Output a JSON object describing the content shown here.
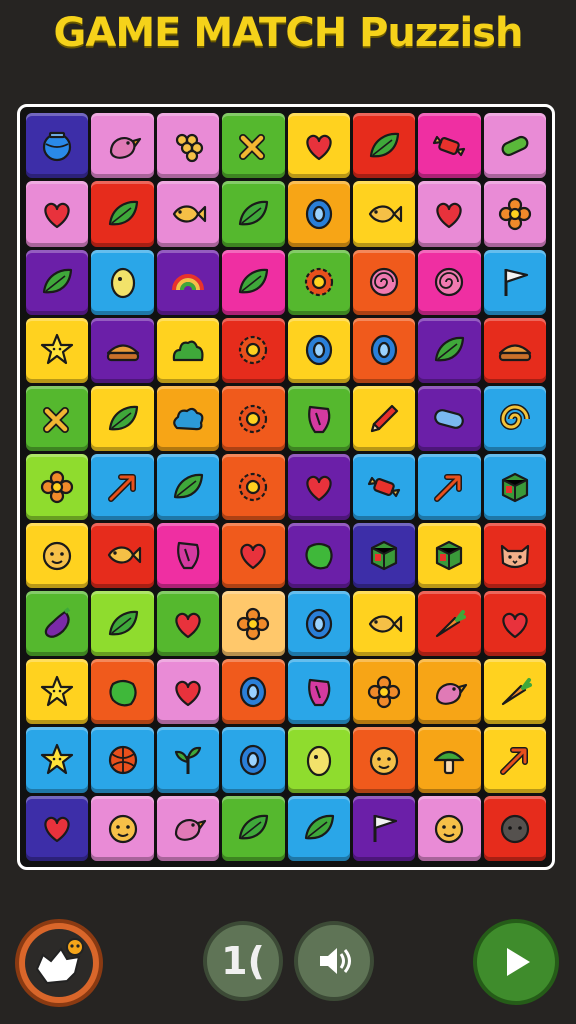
{
  "title": "GAME MATCH Puzzish",
  "tiles": [
    {
      "color": "#3d2ea8",
      "icon": "fish-bowl"
    },
    {
      "color": "#e98bd6",
      "icon": "bird"
    },
    {
      "color": "#e98bd6",
      "icon": "grapes"
    },
    {
      "color": "#55b82e",
      "icon": "cross"
    },
    {
      "color": "#ffd21f",
      "icon": "heart"
    },
    {
      "color": "#e62c1c",
      "icon": "leaf"
    },
    {
      "color": "#ef2fa2",
      "icon": "candy"
    },
    {
      "color": "#e98bd6",
      "icon": "pickle"
    },
    {
      "color": "#e98bd6",
      "icon": "heart"
    },
    {
      "color": "#e62c1c",
      "icon": "leaf"
    },
    {
      "color": "#e98bd6",
      "icon": "fish"
    },
    {
      "color": "#55b82e",
      "icon": "leaf"
    },
    {
      "color": "#f7a516",
      "icon": "ring"
    },
    {
      "color": "#ffd21f",
      "icon": "fish"
    },
    {
      "color": "#e98bd6",
      "icon": "heart"
    },
    {
      "color": "#e98bd6",
      "icon": "flower"
    },
    {
      "color": "#6b1fa8",
      "icon": "leaf"
    },
    {
      "color": "#2aa6e8",
      "icon": "egg"
    },
    {
      "color": "#6b1fa8",
      "icon": "rainbow"
    },
    {
      "color": "#ef2fa2",
      "icon": "leaf"
    },
    {
      "color": "#55b82e",
      "icon": "gear"
    },
    {
      "color": "#f05a1c",
      "icon": "spiral"
    },
    {
      "color": "#ef2fa2",
      "icon": "spiral"
    },
    {
      "color": "#2aa6e8",
      "icon": "flag"
    },
    {
      "color": "#ffd21f",
      "icon": "star"
    },
    {
      "color": "#6b1fa8",
      "icon": "pie"
    },
    {
      "color": "#ffd21f",
      "icon": "bush"
    },
    {
      "color": "#e62c1c",
      "icon": "gear"
    },
    {
      "color": "#ffd21f",
      "icon": "ring"
    },
    {
      "color": "#f05a1c",
      "icon": "ring"
    },
    {
      "color": "#6b1fa8",
      "icon": "leaf"
    },
    {
      "color": "#e62c1c",
      "icon": "pie"
    },
    {
      "color": "#55b82e",
      "icon": "cross"
    },
    {
      "color": "#ffd21f",
      "icon": "leaf"
    },
    {
      "color": "#f7a516",
      "icon": "cloud"
    },
    {
      "color": "#f05a1c",
      "icon": "gear"
    },
    {
      "color": "#55b82e",
      "icon": "shell"
    },
    {
      "color": "#ffd21f",
      "icon": "pencil"
    },
    {
      "color": "#6b1fa8",
      "icon": "capsule"
    },
    {
      "color": "#2aa6e8",
      "icon": "swirl"
    },
    {
      "color": "#8fdc2e",
      "icon": "flower"
    },
    {
      "color": "#2aa6e8",
      "icon": "arrow"
    },
    {
      "color": "#2aa6e8",
      "icon": "leaf"
    },
    {
      "color": "#f05a1c",
      "icon": "gear"
    },
    {
      "color": "#6b1fa8",
      "icon": "heart"
    },
    {
      "color": "#2aa6e8",
      "icon": "candy"
    },
    {
      "color": "#2aa6e8",
      "icon": "arrow"
    },
    {
      "color": "#2aa6e8",
      "icon": "cube"
    },
    {
      "color": "#ffd21f",
      "icon": "face"
    },
    {
      "color": "#e62c1c",
      "icon": "fish"
    },
    {
      "color": "#ef2fa2",
      "icon": "shell"
    },
    {
      "color": "#f05a1c",
      "icon": "heart"
    },
    {
      "color": "#6b1fa8",
      "icon": "blob"
    },
    {
      "color": "#3d2ea8",
      "icon": "cube"
    },
    {
      "color": "#ffd21f",
      "icon": "cube"
    },
    {
      "color": "#e62c1c",
      "icon": "cat"
    },
    {
      "color": "#55b82e",
      "icon": "eggplant"
    },
    {
      "color": "#8fdc2e",
      "icon": "leaf"
    },
    {
      "color": "#55b82e",
      "icon": "heart"
    },
    {
      "color": "#ffc86b",
      "icon": "flower"
    },
    {
      "color": "#2aa6e8",
      "icon": "ring"
    },
    {
      "color": "#ffd21f",
      "icon": "fish"
    },
    {
      "color": "#e62c1c",
      "icon": "carrot"
    },
    {
      "color": "#e62c1c",
      "icon": "heart"
    },
    {
      "color": "#ffd21f",
      "icon": "star"
    },
    {
      "color": "#f05a1c",
      "icon": "blob"
    },
    {
      "color": "#e98bd6",
      "icon": "heart"
    },
    {
      "color": "#f05a1c",
      "icon": "ring"
    },
    {
      "color": "#2aa6e8",
      "icon": "shell"
    },
    {
      "color": "#f7a516",
      "icon": "flower"
    },
    {
      "color": "#f7a516",
      "icon": "bird"
    },
    {
      "color": "#ffd21f",
      "icon": "carrot"
    },
    {
      "color": "#2aa6e8",
      "icon": "star"
    },
    {
      "color": "#2aa6e8",
      "icon": "ball"
    },
    {
      "color": "#2aa6e8",
      "icon": "sprout"
    },
    {
      "color": "#2aa6e8",
      "icon": "ring"
    },
    {
      "color": "#8fdc2e",
      "icon": "egg"
    },
    {
      "color": "#f05a1c",
      "icon": "face"
    },
    {
      "color": "#f7a516",
      "icon": "mushroom"
    },
    {
      "color": "#ffd21f",
      "icon": "arrow"
    },
    {
      "color": "#3d2ea8",
      "icon": "heart"
    },
    {
      "color": "#e98bd6",
      "icon": "face"
    },
    {
      "color": "#e98bd6",
      "icon": "bird"
    },
    {
      "color": "#55b82e",
      "icon": "leaf"
    },
    {
      "color": "#2aa6e8",
      "icon": "leaf"
    },
    {
      "color": "#6b1fa8",
      "icon": "flag"
    },
    {
      "color": "#e98bd6",
      "icon": "face"
    },
    {
      "color": "#e62c1c",
      "icon": "rock"
    }
  ],
  "controls": {
    "counter_label": "1("
  }
}
